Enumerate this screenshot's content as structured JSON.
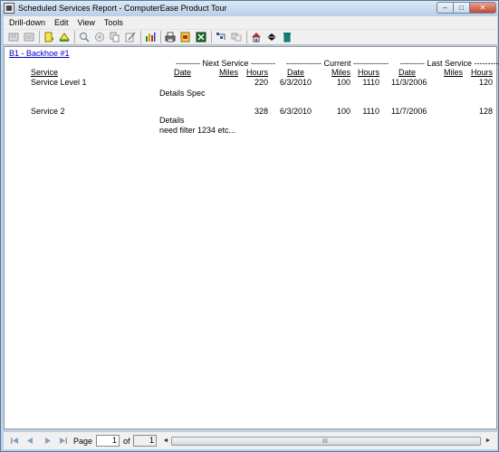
{
  "window": {
    "title": "Scheduled Services Report - ComputerEase Product Tour",
    "app_icon": "report-app-icon",
    "minimize": "–",
    "maximize": "□",
    "close": "✕"
  },
  "menu": {
    "items": [
      "Drill-down",
      "Edit",
      "View",
      "Tools"
    ]
  },
  "toolbar": {
    "icons": [
      "first-page-icon",
      "last-page-icon",
      "export-icon",
      "export-up-icon",
      "zoom-icon",
      "zoom-reset-icon",
      "copy-icon",
      "edit-icon",
      "chart-icon",
      "print-icon",
      "print-preview-icon",
      "export-excel-icon",
      "drill-icon",
      "refresh-icon",
      "home-icon",
      "email-icon",
      "trash-icon"
    ]
  },
  "report": {
    "equipment_link": "B1 - Backhoe #1",
    "group_headers": {
      "next_service": "--------- Next Service ---------",
      "current": "------------- Current -------------",
      "last_service": "--------- Last Service ---------"
    },
    "columns": {
      "service": "Service",
      "next_date": "Date",
      "next_miles": "Miles",
      "next_hours": "Hours",
      "cur_date": "Date",
      "cur_miles": "Miles",
      "cur_hours": "Hours",
      "last_date": "Date",
      "last_miles": "Miles",
      "last_hours": "Hours"
    },
    "rows": [
      {
        "service": "Service Level 1",
        "next_hours": "220",
        "cur_date": "6/3/2010",
        "cur_miles": "100",
        "cur_hours": "1110",
        "last_date": "11/3/2006",
        "last_hours": "120",
        "details": [
          "Details Spec"
        ]
      },
      {
        "service": "Service 2",
        "next_hours": "328",
        "cur_date": "6/3/2010",
        "cur_miles": "100",
        "cur_hours": "1110",
        "last_date": "11/7/2006",
        "last_hours": "128",
        "details": [
          "Details",
          "need filter 1234 etc..."
        ]
      }
    ]
  },
  "statusbar": {
    "page_label": "Page",
    "page_value": "1",
    "of_label": "of",
    "total_pages": "1",
    "scroll_left": "◄",
    "scroll_right": "►",
    "scroll_grip": "III"
  }
}
